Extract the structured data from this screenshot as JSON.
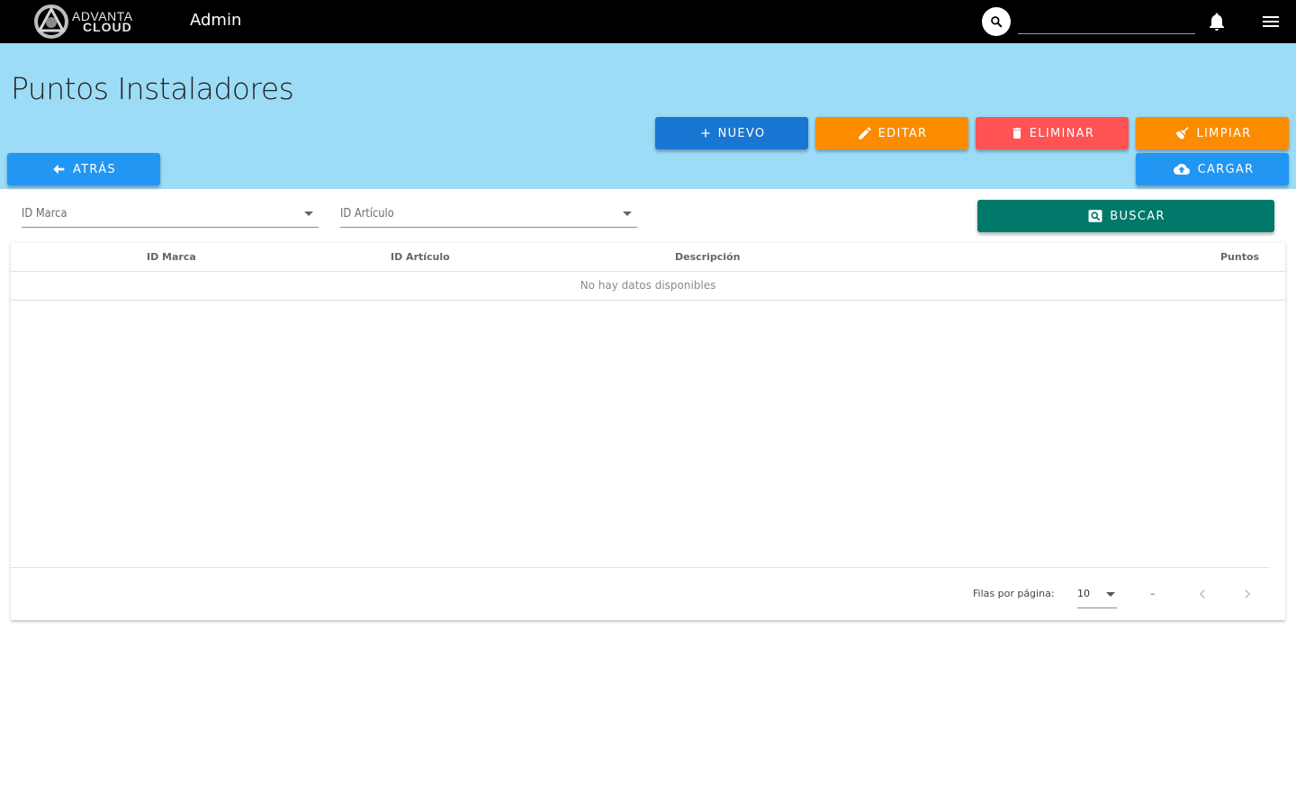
{
  "topbar": {
    "logo_line1": "ADVANTA",
    "logo_line2": "CLOUD",
    "title": "Admin",
    "search_value": "",
    "search_icon": "search-icon",
    "notification_icon": "bell-icon",
    "menu_icon": "hamburger-menu-icon"
  },
  "header": {
    "page_title": "Puntos Instaladores",
    "background_color": "#9ddcf7"
  },
  "actions": {
    "nuevo": "NUEVO",
    "editar": "EDITAR",
    "eliminar": "ELIMINAR",
    "limpiar": "LIMPIAR",
    "atras": "ATRÁS",
    "cargar": "CARGAR",
    "buscar": "BUSCAR"
  },
  "colors": {
    "primary": "#1976d2",
    "info": "#2196f3",
    "warning": "#fb8c00",
    "error": "#ff5252",
    "teal": "#00796b"
  },
  "filters": {
    "marca_label": "ID Marca",
    "articulo_label": "ID Artículo"
  },
  "table": {
    "columns": [
      "ID Marca",
      "ID Artículo",
      "Descripción",
      "Puntos"
    ],
    "empty_text": "No hay datos disponibles",
    "rows": []
  },
  "pagination": {
    "rows_per_page_label": "Filas por página:",
    "rows_per_page_value": "10",
    "page_info": "–"
  }
}
